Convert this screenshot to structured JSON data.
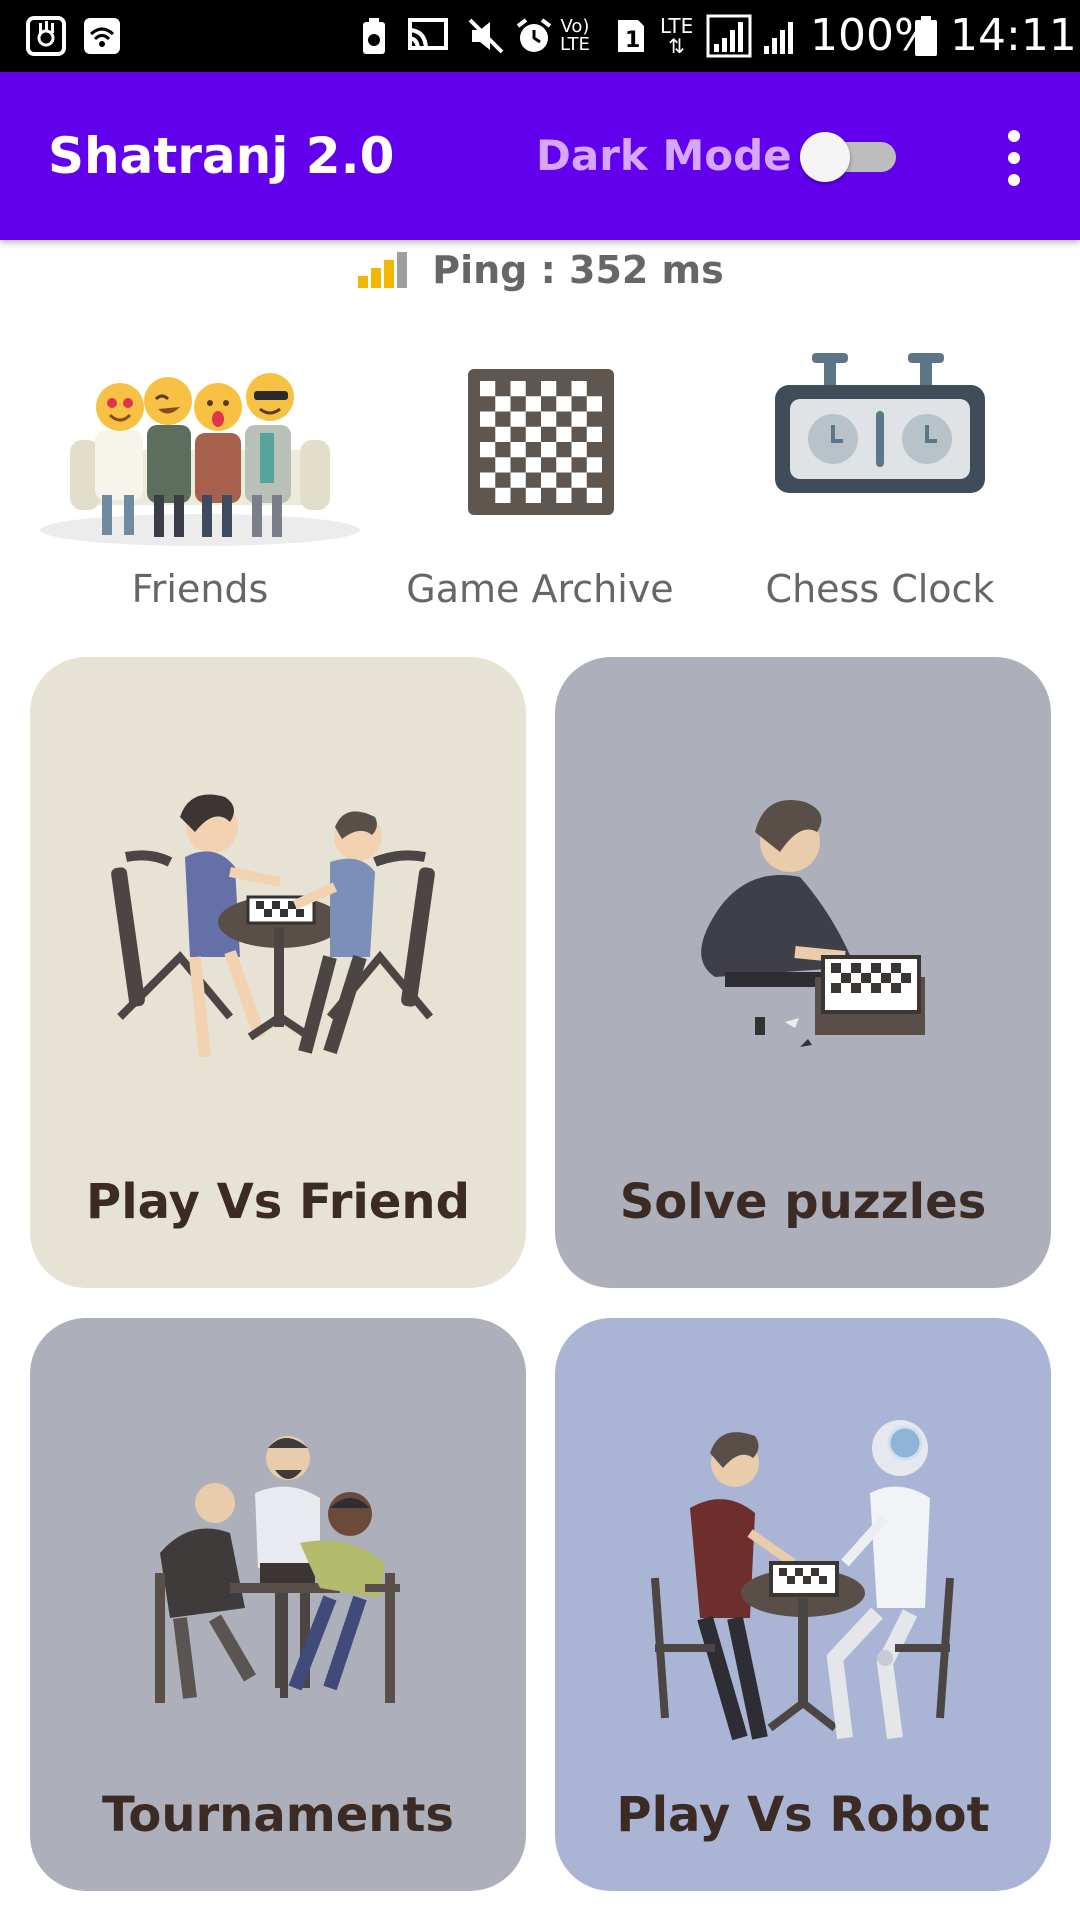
{
  "status_bar": {
    "battery": "100%",
    "time": "14:11",
    "network": "LTE"
  },
  "app_bar": {
    "title": "Shatranj 2.0",
    "dark_mode_label": "Dark Mode",
    "dark_mode_on": false,
    "accent_color": "#6200ee"
  },
  "ping": {
    "text": "Ping : 352 ms"
  },
  "shortcuts": [
    {
      "label": "Friends",
      "icon": "friends-group-illustration"
    },
    {
      "label": "Game Archive",
      "icon": "chessboard-icon"
    },
    {
      "label": "Chess Clock",
      "icon": "chess-clock-icon"
    }
  ],
  "cards": [
    {
      "label": "Play Vs Friend",
      "color": "#e7e3d4"
    },
    {
      "label": "Solve puzzles",
      "color": "#adb0bb"
    },
    {
      "label": "Tournaments",
      "color": "#adb0bb"
    },
    {
      "label": "Play Vs Robot",
      "color": "#aab5d6"
    }
  ]
}
